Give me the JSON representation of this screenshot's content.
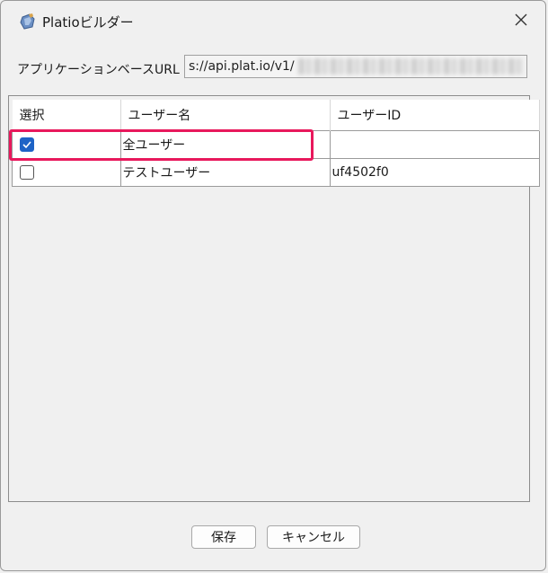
{
  "window": {
    "title": "Platioビルダー",
    "app_icon": "platio-builder-icon",
    "close_icon": "close-icon"
  },
  "url_row": {
    "label": "アプリケーションベースURL",
    "value": "s://api.plat.io/v1/"
  },
  "table": {
    "headers": [
      "選択",
      "ユーザー名",
      "ユーザーID"
    ],
    "rows": [
      {
        "checked": true,
        "name": "全ユーザー",
        "id": ""
      },
      {
        "checked": false,
        "name": "テストユーザー",
        "id": "uf4502f0"
      }
    ],
    "highlight_color": "#e8185c",
    "check_color": "#1e63c6"
  },
  "buttons": {
    "save_label": "保存",
    "cancel_label": "キャンセル"
  }
}
